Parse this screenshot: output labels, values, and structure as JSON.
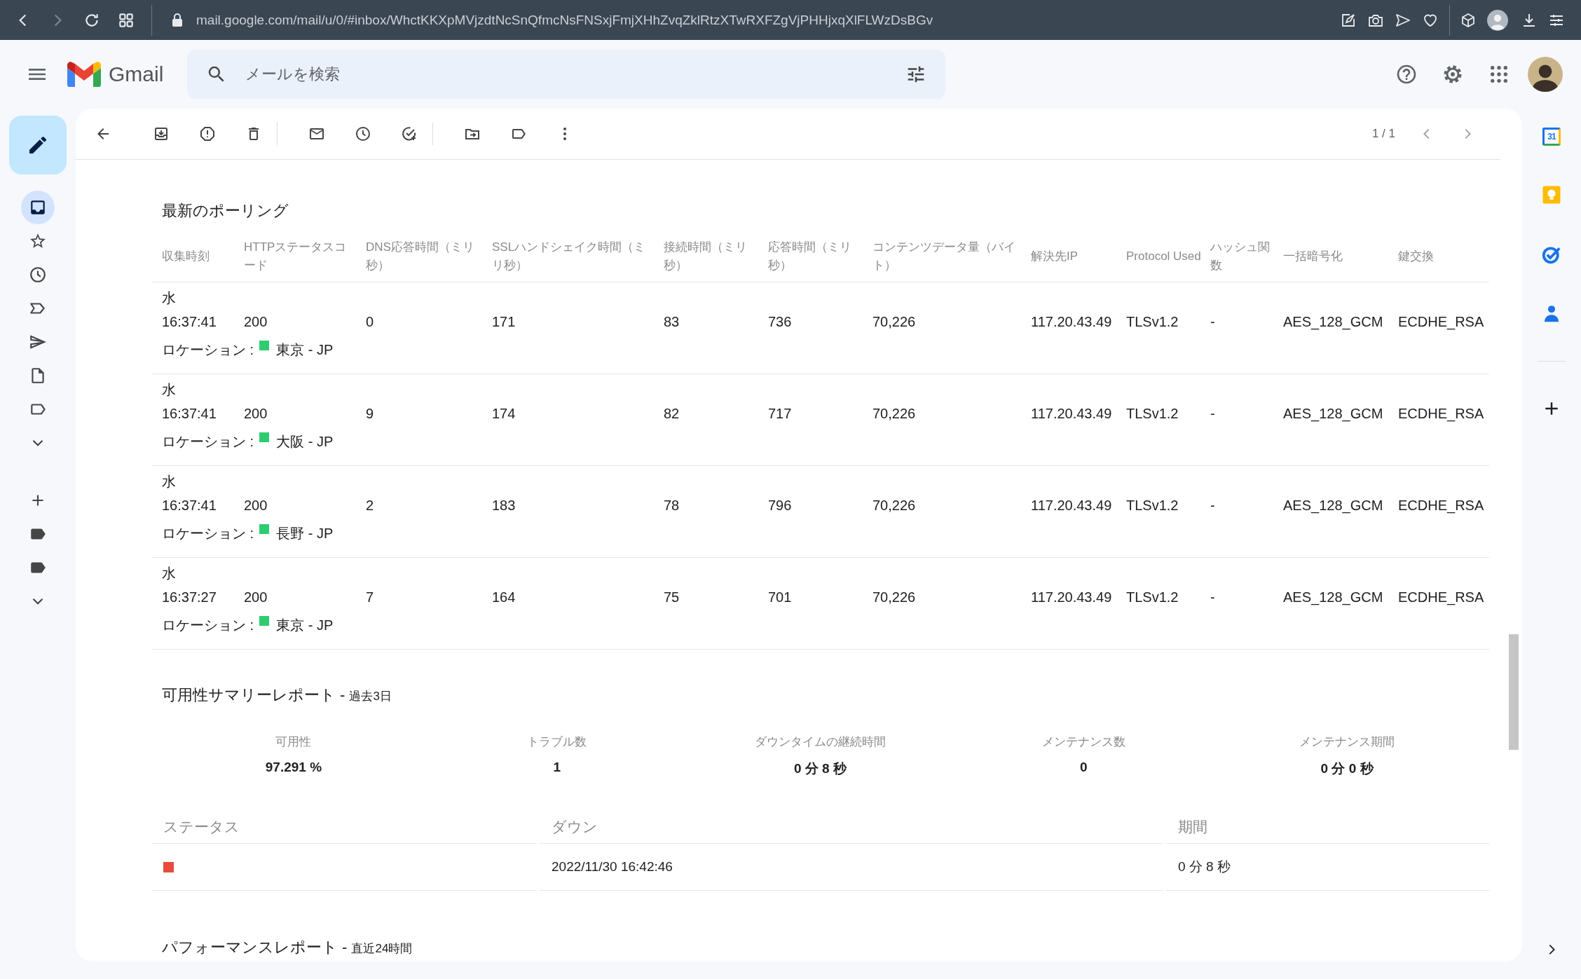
{
  "browser": {
    "url": "mail.google.com/mail/u/0/#inbox/WhctKKXpMVjzdtNcSnQfmcNsFNSxjFmjXHhZvqZklRtzXTwRXFZgVjPHHjxqXlFLWzDsBGv"
  },
  "app": {
    "name": "Gmail"
  },
  "search": {
    "placeholder": "メールを検索"
  },
  "nav": [
    {
      "selected": true
    },
    {
      "selected": false
    },
    {
      "selected": false
    },
    {
      "selected": false
    },
    {
      "selected": false
    },
    {
      "selected": false
    },
    {
      "selected": false
    },
    {
      "selected": false
    }
  ],
  "toolbar": {
    "paging": "1 / 1"
  },
  "side_panel": {
    "calendar_day": "31"
  },
  "polling": {
    "title": "最新のポーリング",
    "columns": [
      "収集時刻",
      "HTTPステータスコード",
      "DNS応答時間（ミリ秒）",
      "SSLハンドシェイク時間（ミリ秒）",
      "接続時間（ミリ秒）",
      "応答時間（ミリ秒）",
      "コンテンツデータ量（バイト）",
      "解決先IP",
      "Protocol Used",
      "ハッシュ関数",
      "一括暗号化",
      "鍵交換"
    ],
    "rows": [
      {
        "day": "水",
        "cells": [
          "16:37:41",
          "200",
          "0",
          "171",
          "83",
          "736",
          "70,226",
          "117.20.43.49",
          "TLSv1.2",
          "-",
          "AES_128_GCM",
          "ECDHE_RSA"
        ],
        "location_label": "ロケーション :",
        "location": "東京 - JP",
        "color": "#2ecc71"
      },
      {
        "day": "水",
        "cells": [
          "16:37:41",
          "200",
          "9",
          "174",
          "82",
          "717",
          "70,226",
          "117.20.43.49",
          "TLSv1.2",
          "-",
          "AES_128_GCM",
          "ECDHE_RSA"
        ],
        "location_label": "ロケーション :",
        "location": "大阪 - JP",
        "color": "#2ecc71"
      },
      {
        "day": "水",
        "cells": [
          "16:37:41",
          "200",
          "2",
          "183",
          "78",
          "796",
          "70,226",
          "117.20.43.49",
          "TLSv1.2",
          "-",
          "AES_128_GCM",
          "ECDHE_RSA"
        ],
        "location_label": "ロケーション :",
        "location": "長野 - JP",
        "color": "#2ecc71"
      },
      {
        "day": "水",
        "cells": [
          "16:37:27",
          "200",
          "7",
          "164",
          "75",
          "701",
          "70,226",
          "117.20.43.49",
          "TLSv1.2",
          "-",
          "AES_128_GCM",
          "ECDHE_RSA"
        ],
        "location_label": "ロケーション :",
        "location": "東京 - JP",
        "color": "#2ecc71"
      }
    ]
  },
  "summary": {
    "title": "可用性サマリーレポート -",
    "period": "過去3日",
    "stats": [
      {
        "label": "可用性",
        "value": "97.291 %"
      },
      {
        "label": "トラブル数",
        "value": "1"
      },
      {
        "label": "ダウンタイムの継続時間",
        "value": "0 分 8 秒"
      },
      {
        "label": "メンテナンス数",
        "value": "0"
      },
      {
        "label": "メンテナンス期間",
        "value": "0 分 0 秒"
      }
    ],
    "status_table": {
      "columns": [
        "ステータス",
        "ダウン",
        "期間"
      ],
      "rows": [
        {
          "color": "#e74c3c",
          "down": "2022/11/30 16:42:46",
          "duration": "0 分 8 秒"
        }
      ]
    }
  },
  "performance": {
    "title": "パフォーマンスレポート -",
    "period": "直近24時間"
  }
}
